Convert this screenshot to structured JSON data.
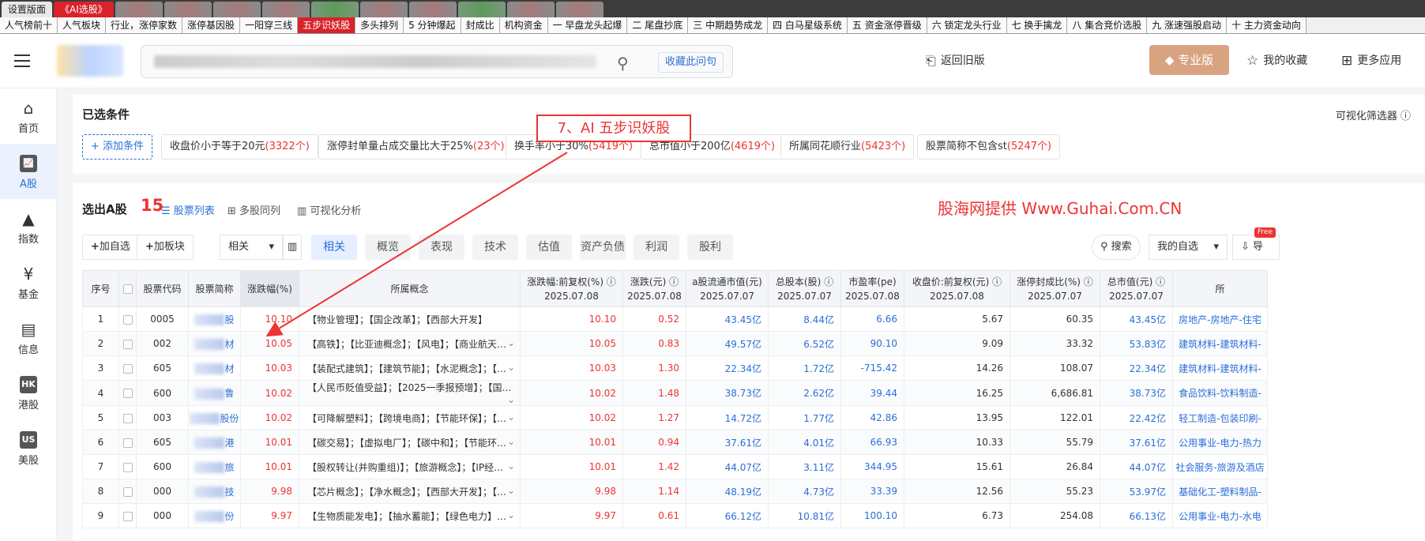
{
  "top_tabs": [
    {
      "label": "设置版面",
      "kind": "first"
    },
    {
      "label": "《AI选股》",
      "kind": "active"
    },
    {
      "label": "",
      "kind": "blur"
    },
    {
      "label": "",
      "kind": "blur"
    },
    {
      "label": "",
      "kind": "blur"
    },
    {
      "label": "",
      "kind": "blur"
    },
    {
      "label": "",
      "kind": "blur-g"
    },
    {
      "label": "",
      "kind": "blur"
    },
    {
      "label": "",
      "kind": "blur"
    },
    {
      "label": "",
      "kind": "blur-g"
    },
    {
      "label": "",
      "kind": "blur"
    },
    {
      "label": "",
      "kind": "blur"
    }
  ],
  "sub_tabs": [
    {
      "label": "人气榜前十",
      "active": false
    },
    {
      "label": "人气板块",
      "active": false
    },
    {
      "label": "行业，涨停家数",
      "active": false
    },
    {
      "label": "涨停基因股",
      "active": false
    },
    {
      "label": "一阳穿三线",
      "active": false
    },
    {
      "label": "五步识妖股",
      "active": true
    },
    {
      "label": "多头排列",
      "active": false
    },
    {
      "label": "5 分钟爆起",
      "active": false
    },
    {
      "label": "封成比",
      "active": false
    },
    {
      "label": "机构资金",
      "active": false
    },
    {
      "label": "一 早盘龙头起爆",
      "active": false
    },
    {
      "label": "二 尾盘抄底",
      "active": false
    },
    {
      "label": "三 中期趋势成龙",
      "active": false
    },
    {
      "label": "四 白马星级系统",
      "active": false
    },
    {
      "label": "五 资金涨停晋级",
      "active": false
    },
    {
      "label": "六 锁定龙头行业",
      "active": false
    },
    {
      "label": "七 换手擒龙",
      "active": false
    },
    {
      "label": "八 集合竞价选股",
      "active": false
    },
    {
      "label": "九 涨速强股启动",
      "active": false
    },
    {
      "label": "十 主力资金动向",
      "active": false
    }
  ],
  "header": {
    "search_icon": "magnifier-icon",
    "fav_label": "收藏此问句",
    "back_label": "返回旧版",
    "pro_label": "专业版",
    "my_fav_label": "我的收藏",
    "more_label": "更多应用"
  },
  "sidebar": [
    {
      "label": "首页",
      "icon": "home-icon",
      "glyph": "⌂",
      "active": false
    },
    {
      "label": "A股",
      "icon": "chart-icon",
      "glyph": "📈",
      "active": true
    },
    {
      "label": "指数",
      "icon": "index-icon",
      "glyph": "▲",
      "active": false
    },
    {
      "label": "基金",
      "icon": "yen-icon",
      "glyph": "¥",
      "active": false
    },
    {
      "label": "信息",
      "icon": "news-icon",
      "glyph": "▤",
      "active": false
    },
    {
      "label": "港股",
      "icon": "hk-icon",
      "glyph": "HK",
      "active": false
    },
    {
      "label": "美股",
      "icon": "us-icon",
      "glyph": "US",
      "active": false
    }
  ],
  "conditions": {
    "title": "已选条件",
    "add_label": "+ 添加条件",
    "visual_filter_label": "可视化筛选器 ⓘ",
    "chips": [
      {
        "label": "收盘价小于等于20元",
        "count": "(3322个)"
      },
      {
        "label": "涨停封单量占成交量比大于25%",
        "count": "(23个)"
      },
      {
        "label": "换手率小于30%",
        "count": "(5419个)"
      },
      {
        "label": "总市值小于200亿",
        "count": "(4619个)"
      },
      {
        "label": "所属同花顺行业",
        "count": "(5423个)"
      },
      {
        "label": "股票简称不包含st",
        "count": "(5247个)"
      }
    ]
  },
  "annotation": "7、AI 五步识妖股",
  "results": {
    "title": "选出A股",
    "count": "15",
    "view_tabs": [
      "股票列表",
      "多股同列",
      "可视化分析"
    ],
    "watermark": "股海网提供 Www.Guhai.Com.CN",
    "add_pick": "加自选",
    "add_block": "加板块",
    "sort_select": "相关",
    "field_tabs": [
      "相关",
      "概览",
      "表现",
      "技术",
      "估值",
      "资产负债",
      "利润",
      "股利"
    ],
    "search_label": "搜索",
    "my_pick_select": "我的自选",
    "export_label": "导",
    "free_badge": "Free"
  },
  "table": {
    "headers": [
      {
        "l1": "序号",
        "l2": ""
      },
      {
        "l1": "",
        "l2": ""
      },
      {
        "l1": "股票代码",
        "l2": ""
      },
      {
        "l1": "股票简称",
        "l2": ""
      },
      {
        "l1": "涨跌幅(%)",
        "l2": ""
      },
      {
        "l1": "所属概念",
        "l2": ""
      },
      {
        "l1": "涨跌幅:前复权(%) ⓘ",
        "l2": "2025.07.08"
      },
      {
        "l1": "涨跌(元) ⓘ",
        "l2": "2025.07.08"
      },
      {
        "l1": "a股流通市值(元)",
        "l2": "2025.07.07"
      },
      {
        "l1": "总股本(股) ⓘ",
        "l2": "2025.07.07"
      },
      {
        "l1": "市盈率(pe)",
        "l2": "2025.07.08"
      },
      {
        "l1": "收盘价:前复权(元) ⓘ",
        "l2": "2025.07.08"
      },
      {
        "l1": "涨停封成比(%) ⓘ",
        "l2": "2025.07.07"
      },
      {
        "l1": "总市值(元) ⓘ",
        "l2": "2025.07.07"
      },
      {
        "l1": "所",
        "l2": ""
      }
    ],
    "rows": [
      {
        "no": "1",
        "code": "0005",
        "name": "股",
        "chg": "10.10",
        "concept": "【物业管理】；【国企改革】；【西部大开发】",
        "chg2": "10.10",
        "amt": "0.52",
        "float_cap": "43.45亿",
        "shares": "8.44亿",
        "pe": "6.66",
        "close": "5.67",
        "seal": "60.35",
        "cap": "43.45亿",
        "industry": "房地产-房地产-住宅"
      },
      {
        "no": "2",
        "code": "002",
        "name": "材",
        "chg": "10.05",
        "concept": "【高铁】；【比亚迪概念】；【风电】；【商业航天…",
        "chg2": "10.05",
        "amt": "0.83",
        "float_cap": "49.57亿",
        "shares": "6.52亿",
        "pe": "90.10",
        "close": "9.09",
        "seal": "33.32",
        "cap": "53.83亿",
        "industry": "建筑材料-建筑材料-"
      },
      {
        "no": "3",
        "code": "605",
        "name": "材",
        "chg": "10.03",
        "concept": "【装配式建筑】；【建筑节能】；【水泥概念】；【…",
        "chg2": "10.03",
        "amt": "1.30",
        "float_cap": "22.34亿",
        "shares": "1.72亿",
        "pe": "-715.42",
        "close": "14.26",
        "seal": "108.07",
        "cap": "22.34亿",
        "industry": "建筑材料-建筑材料-"
      },
      {
        "no": "4",
        "code": "600",
        "name": "鲁",
        "chg": "10.02",
        "concept": "【人民币贬值受益】；【2025一季报预增】；【国…",
        "chg2": "10.02",
        "amt": "1.48",
        "float_cap": "38.73亿",
        "shares": "2.62亿",
        "pe": "39.44",
        "close": "16.25",
        "seal": "6,686.81",
        "cap": "38.73亿",
        "industry": "食品饮料-饮料制造-"
      },
      {
        "no": "5",
        "code": "003",
        "name": "股份",
        "chg": "10.02",
        "concept": "【可降解塑料】；【跨境电商】；【节能环保】；【…",
        "chg2": "10.02",
        "amt": "1.27",
        "float_cap": "14.72亿",
        "shares": "1.77亿",
        "pe": "42.86",
        "close": "13.95",
        "seal": "122.01",
        "cap": "22.42亿",
        "industry": "轻工制造-包装印刷-"
      },
      {
        "no": "6",
        "code": "605",
        "name": "港",
        "chg": "10.01",
        "concept": "【碳交易】；【虚拟电厂】；【碳中和】；【节能环…",
        "chg2": "10.01",
        "amt": "0.94",
        "float_cap": "37.61亿",
        "shares": "4.01亿",
        "pe": "66.93",
        "close": "10.33",
        "seal": "55.79",
        "cap": "37.61亿",
        "industry": "公用事业-电力-热力"
      },
      {
        "no": "7",
        "code": "600",
        "name": "旅",
        "chg": "10.01",
        "concept": "【股权转让(并购重组)】；【旅游概念】；【IP经…",
        "chg2": "10.01",
        "amt": "1.42",
        "float_cap": "44.07亿",
        "shares": "3.11亿",
        "pe": "344.95",
        "close": "15.61",
        "seal": "26.84",
        "cap": "44.07亿",
        "industry": "社会服务-旅游及酒店"
      },
      {
        "no": "8",
        "code": "000",
        "name": "技",
        "chg": "9.98",
        "concept": "【芯片概念】；【净水概念】；【西部大开发】；【…",
        "chg2": "9.98",
        "amt": "1.14",
        "float_cap": "48.19亿",
        "shares": "4.73亿",
        "pe": "33.39",
        "close": "12.56",
        "seal": "55.23",
        "cap": "53.97亿",
        "industry": "基础化工-塑料制品-"
      },
      {
        "no": "9",
        "code": "000",
        "name": "份",
        "chg": "9.97",
        "concept": "【生物质能发电】；【抽水蓄能】；【绿色电力】…",
        "chg2": "9.97",
        "amt": "0.61",
        "float_cap": "66.12亿",
        "shares": "10.81亿",
        "pe": "100.10",
        "close": "6.73",
        "seal": "254.08",
        "cap": "66.13亿",
        "industry": "公用事业-电力-水电"
      }
    ]
  },
  "colors": {
    "accent": "#2a6fd8",
    "red": "#e33",
    "pro": "#d9a382"
  }
}
